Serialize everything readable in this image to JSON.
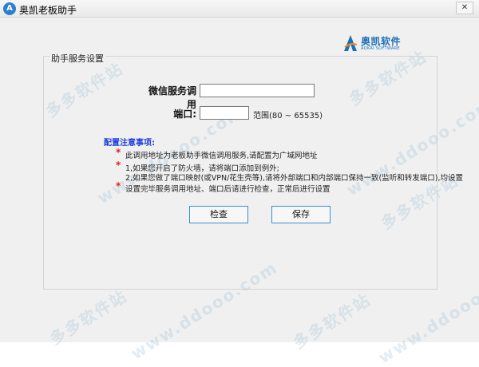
{
  "window": {
    "title": "奥凯老板助手",
    "close_label": "✕"
  },
  "logo": {
    "name_cn": "奥凯软件",
    "name_en": "AOKAI SOFTWARE"
  },
  "group": {
    "legend": "助手服务设置"
  },
  "form": {
    "wechat_label": "微信服务调用",
    "wechat_value": "",
    "port_label": "端口:",
    "port_value": "",
    "port_range": "范围(80 ~ 65535)"
  },
  "notes": {
    "title": "配置注意事项:",
    "star": "*",
    "items": [
      "此调用地址为老板助手微信调用服务,请配置为广域网地址",
      "1,如果您开启了防火墙，请将端口添加到例外;",
      "2,如果您做了端口映射(或VPN/花生壳等),请将外部端口和内部端口保持一致(监听和转发端口),均设置",
      "设置完毕服务调用地址、端口后请进行检查，正常后进行设置"
    ]
  },
  "buttons": {
    "check_label": "检查",
    "save_label": "保存"
  },
  "watermark": {
    "text_cn": "多多软件站",
    "text_en": "www.ddooo.com"
  },
  "colors": {
    "accent": "#1d6fb8",
    "notes_title": "#1f3fd8",
    "star": "#e02020",
    "button_border": "#3a8fd0"
  }
}
